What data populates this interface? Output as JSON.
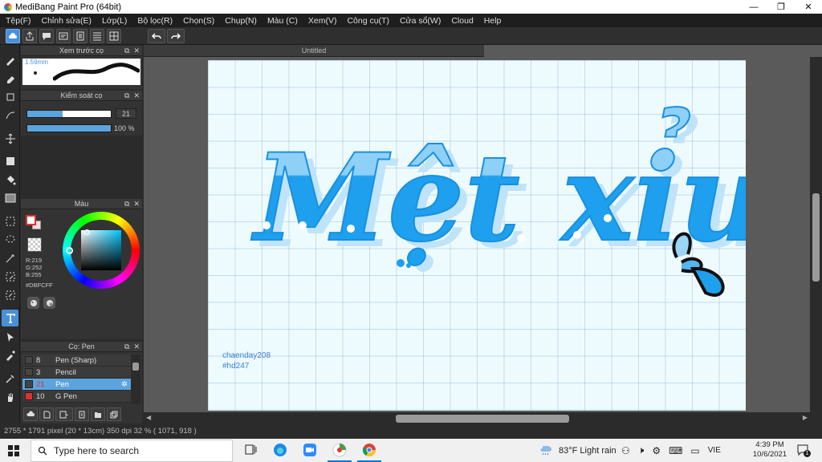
{
  "window": {
    "title": "MediBang Paint Pro (64bit)",
    "controls": [
      "—",
      "❐",
      "✕"
    ]
  },
  "menu": [
    "Tệp(F)",
    "Chỉnh sửa(E)",
    "Lớp(L)",
    "Bộ lọc(R)",
    "Chọn(S)",
    "Chụp(N)",
    "Màu (C)",
    "Xem(V)",
    "Công cụ(T)",
    "Cửa sổ(W)",
    "Cloud",
    "Help"
  ],
  "panels": {
    "brush_preview": {
      "title": "Xem trước cọ",
      "size_label": "1.59mm"
    },
    "brush_control": {
      "title": "Kiểm soát cọ",
      "size_value": "21",
      "size_fraction": 0.42,
      "opacity_value": "100 %",
      "opacity_fraction": 1.0
    },
    "color": {
      "title": "Màu",
      "r": "R:219",
      "g": "G:252",
      "b": "B:255",
      "hex": "#DBFCFF",
      "fg_color": "#ffffff"
    },
    "brush_list": {
      "title": "Cọ: Pen",
      "items": [
        {
          "num": "8",
          "name": "Pen (Sharp)",
          "color": "#444444",
          "selected": false
        },
        {
          "num": "3",
          "name": "Pencil",
          "color": "#444444",
          "selected": false
        },
        {
          "num": "21",
          "name": "Pen",
          "color": "#444444",
          "selected": true
        },
        {
          "num": "10",
          "name": "G Pen",
          "color": "#e03030",
          "selected": false
        }
      ]
    }
  },
  "document": {
    "tab_title": "Untitled",
    "canvas_text": "Mệt xỉu",
    "signature_line1": "chaenday208",
    "signature_line2": "#hd247"
  },
  "status": {
    "text": "2755 * 1791 pixel  (20 * 13cm)  350 dpi  32 %  ( 1071, 918 )"
  },
  "taskbar": {
    "search_placeholder": "Type here to search",
    "weather": "83°F  Light rain",
    "language": "VIE",
    "time": "4:39 PM",
    "date": "10/6/2021",
    "notification_count": "1"
  },
  "colors": {
    "accent": "#4a90d9",
    "lettering_blue": "#1ea0ee",
    "lettering_shadow": "#8ecdf6",
    "paper": "#eefbfe"
  }
}
